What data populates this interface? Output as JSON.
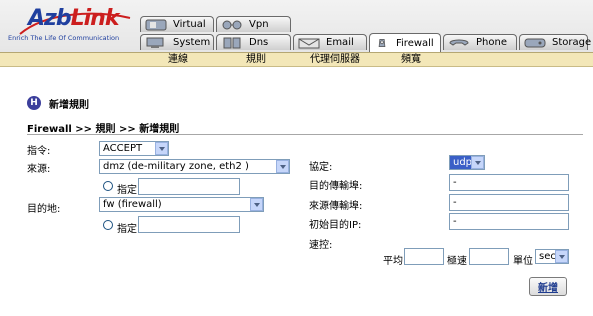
{
  "brand": {
    "logo_a": "Azb",
    "logo_b": "Link",
    "tagline": "Enrich The Life Of Communication"
  },
  "tabs_top": [
    {
      "label": "Virtual",
      "icon": "virtual-icon"
    },
    {
      "label": "Vpn",
      "icon": "vpn-icon"
    }
  ],
  "tabs_bottom": [
    {
      "label": "System",
      "icon": "system-icon"
    },
    {
      "label": "Dns",
      "icon": "dns-icon"
    },
    {
      "label": "Email",
      "icon": "email-icon"
    },
    {
      "label": "Firewall",
      "icon": "firewall-icon",
      "active": true
    },
    {
      "label": "Phone",
      "icon": "phone-icon"
    },
    {
      "label": "Storage",
      "icon": "storage-icon"
    }
  ],
  "subnav": [
    "連線",
    "規則",
    "代理伺服器",
    "頻寬"
  ],
  "page": {
    "title_icon": "H",
    "title": "新增規則",
    "breadcrumb": "Firewall >> 規則 >> 新增規則"
  },
  "form": {
    "directive_label": "指令:",
    "directive_value": "ACCEPT",
    "source_label": "來源:",
    "source_value": "dmz (de-military zone, eth2 )",
    "source_specify": "指定",
    "source_specify_value": "",
    "dest_label": "目的地:",
    "dest_value": "fw (firewall)",
    "dest_specify": "指定",
    "dest_specify_value": "",
    "protocol_label": "協定:",
    "protocol_value": "udp",
    "dest_port_label": "目的傳輸埠:",
    "dest_port_value": "-",
    "src_port_label": "來源傳輸埠:",
    "src_port_value": "-",
    "orig_dest_ip_label": "初始目的IP:",
    "orig_dest_ip_value": "-",
    "rate_label": "速控:",
    "avg_label": "平均",
    "avg_value": "",
    "burst_label": "極速",
    "burst_value": "",
    "unit_label": "單位",
    "unit_value": "sec",
    "submit": "新增"
  },
  "colors": {
    "subnav_bg": "#f3e7b8",
    "brand_blue": "#1f3f9f",
    "brand_red": "#cc1e1e",
    "select_highlight": "#3a5fc7"
  }
}
